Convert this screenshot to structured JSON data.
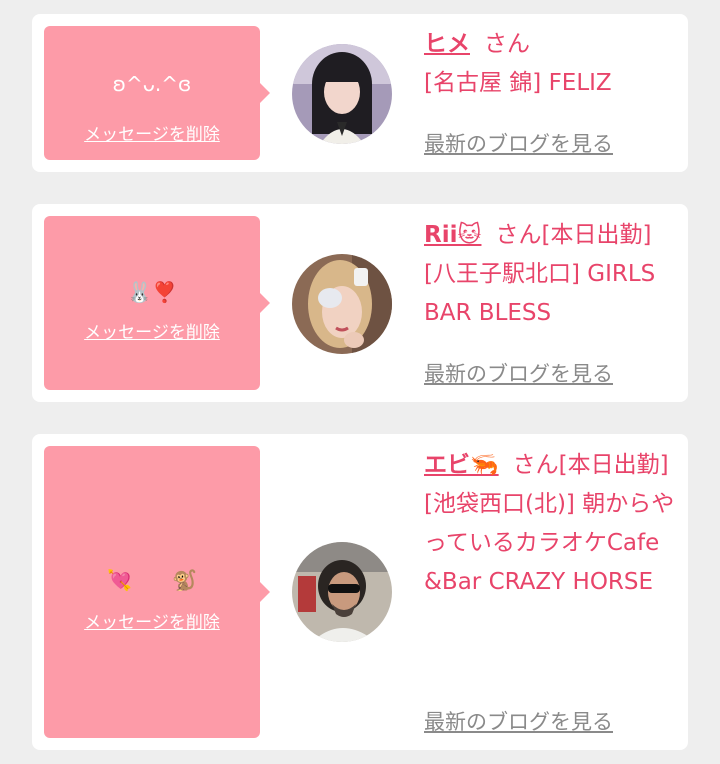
{
  "accent_color": "#e8446a",
  "bubble_color": "#fd9ba8",
  "link_gray": "#8a8a8a",
  "messages": [
    {
      "message_text": "ʚ^ᴗ.^ɞ",
      "delete_label": "メッセージを削除",
      "name": "ヒメ",
      "honorific": "さん",
      "status": "",
      "shop": "[名古屋 錦] FELIZ",
      "blog_label": "最新のブログを見る"
    },
    {
      "message_text": "🐰❣️",
      "delete_label": "メッセージを削除",
      "name": "Rii🐱",
      "honorific": "さん",
      "status": "[本日出勤]",
      "shop": "[八王子駅北口] GIRLS BAR BLESS",
      "blog_label": "最新のブログを見る"
    },
    {
      "message_text": "💘　　🐒",
      "delete_label": "メッセージを削除",
      "name": "エビ🦐",
      "honorific": "さん",
      "status": "[本日出勤]",
      "shop": "[池袋西口(北)] 朝からやっているカラオケCafe&Bar CRAZY HORSE",
      "blog_label": "最新のブログを見る"
    }
  ]
}
